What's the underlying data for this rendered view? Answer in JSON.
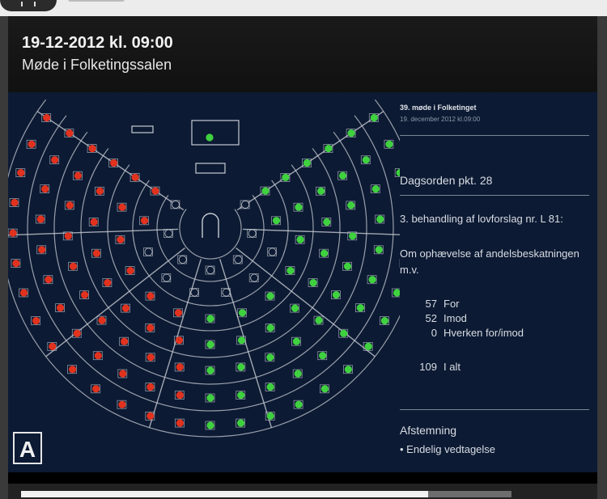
{
  "header": {
    "date_time": "19-12-2012 kl. 09:00",
    "location": "Møde i Folketingssalen"
  },
  "info": {
    "meeting": "39. møde i Folketinget",
    "meeting_date": "19. december 2012 kl.09:00",
    "agenda_item": "Dagsorden pkt. 28",
    "reading": "3. behandling af lovforslag nr. L 81:",
    "subject": "Om ophævelse af andelsbeskatningen m.v.",
    "votes": [
      {
        "count": "57",
        "label": "For"
      },
      {
        "count": "52",
        "label": "Imod"
      },
      {
        "count": "0",
        "label": "Hverken for/imod"
      }
    ],
    "total": {
      "count": "109",
      "label": "I alt"
    },
    "vote_title": "Afstemning",
    "vote_type": "• Endelig vedtagelse"
  },
  "badge": {
    "letter": "A"
  },
  "progress": {
    "fraction": 0.83
  },
  "colors": {
    "for": "#3fd13f",
    "against": "#e0321e",
    "empty_seat": "#0c1a33",
    "wall": "#c8ccd4"
  }
}
